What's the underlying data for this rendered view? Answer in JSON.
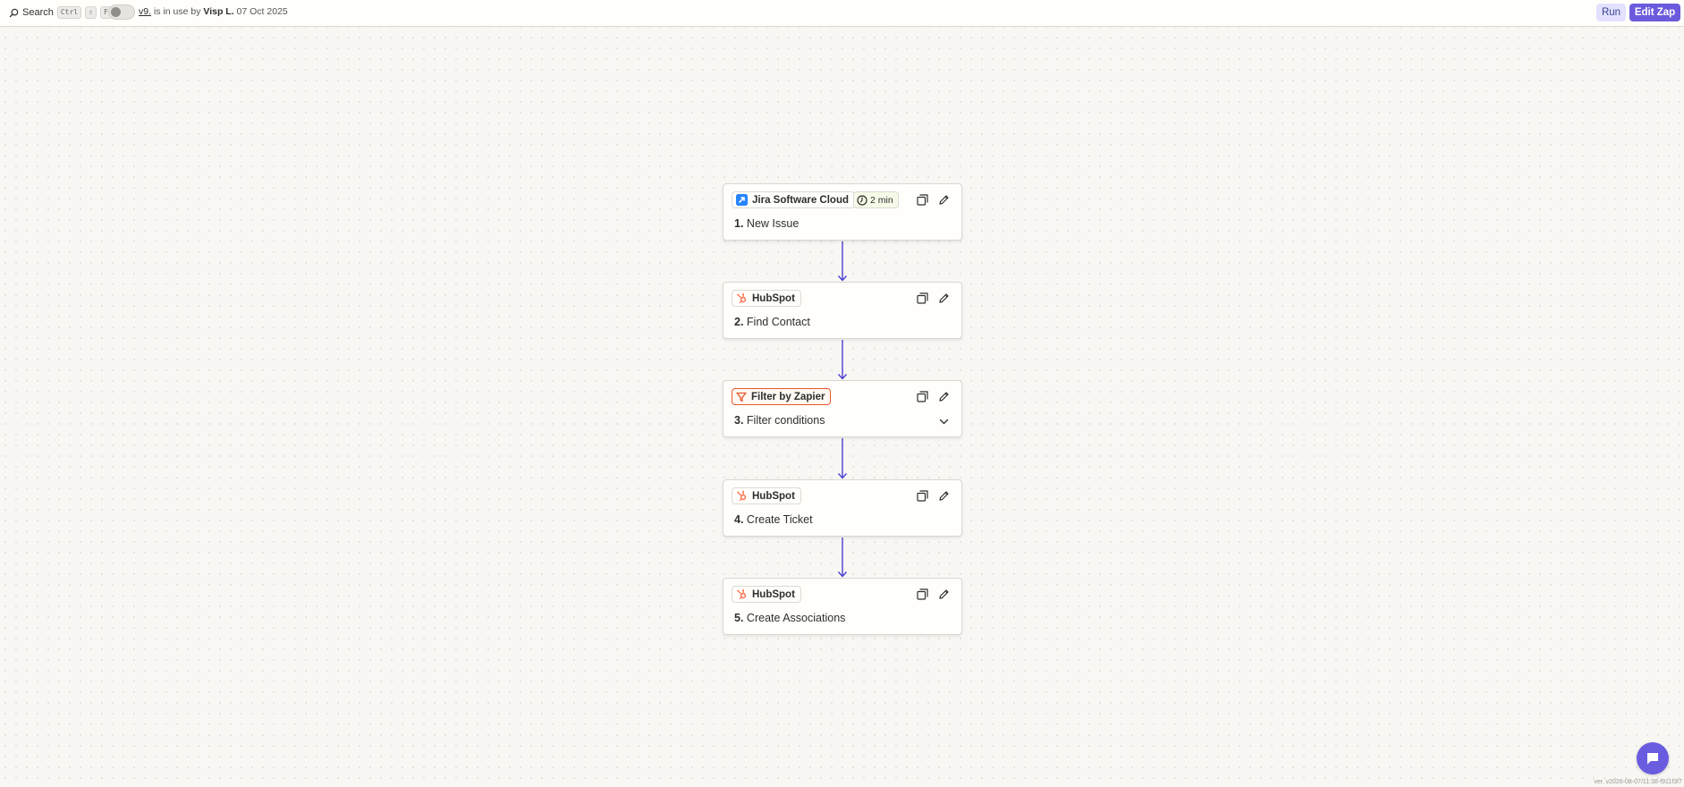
{
  "topbar": {
    "search_label": "Search",
    "shortcut_keys": [
      "Ctrl",
      "⇧",
      "F"
    ],
    "toggle_on": false,
    "version_link": "v9.",
    "in_use_text": "is in use by",
    "user": "Visp L.",
    "date": "07 Oct 2025",
    "run_label": "Run",
    "edit_label": "Edit Zap"
  },
  "steps": [
    {
      "app": "Jira Software Cloud",
      "icon": "jira-icon",
      "number": "1.",
      "title": "New Issue",
      "badge": "2 min"
    },
    {
      "app": "HubSpot",
      "icon": "hubspot-icon",
      "number": "2.",
      "title": "Find Contact"
    },
    {
      "app": "Filter by Zapier",
      "icon": "filter-icon",
      "number": "3.",
      "title": "Filter conditions",
      "expandable": true
    },
    {
      "app": "HubSpot",
      "icon": "hubspot-icon",
      "number": "4.",
      "title": "Create Ticket"
    },
    {
      "app": "HubSpot",
      "icon": "hubspot-icon",
      "number": "5.",
      "title": "Create Associations"
    }
  ],
  "footer": {
    "version_text": "ver. v2026-08-07/11:38-f911f3f7"
  },
  "colors": {
    "accent": "#6b5bdc",
    "connector": "#4b3fd1",
    "filter": "#e8582a",
    "hubspot": "#ff7a59",
    "jira": "#2684ff"
  }
}
